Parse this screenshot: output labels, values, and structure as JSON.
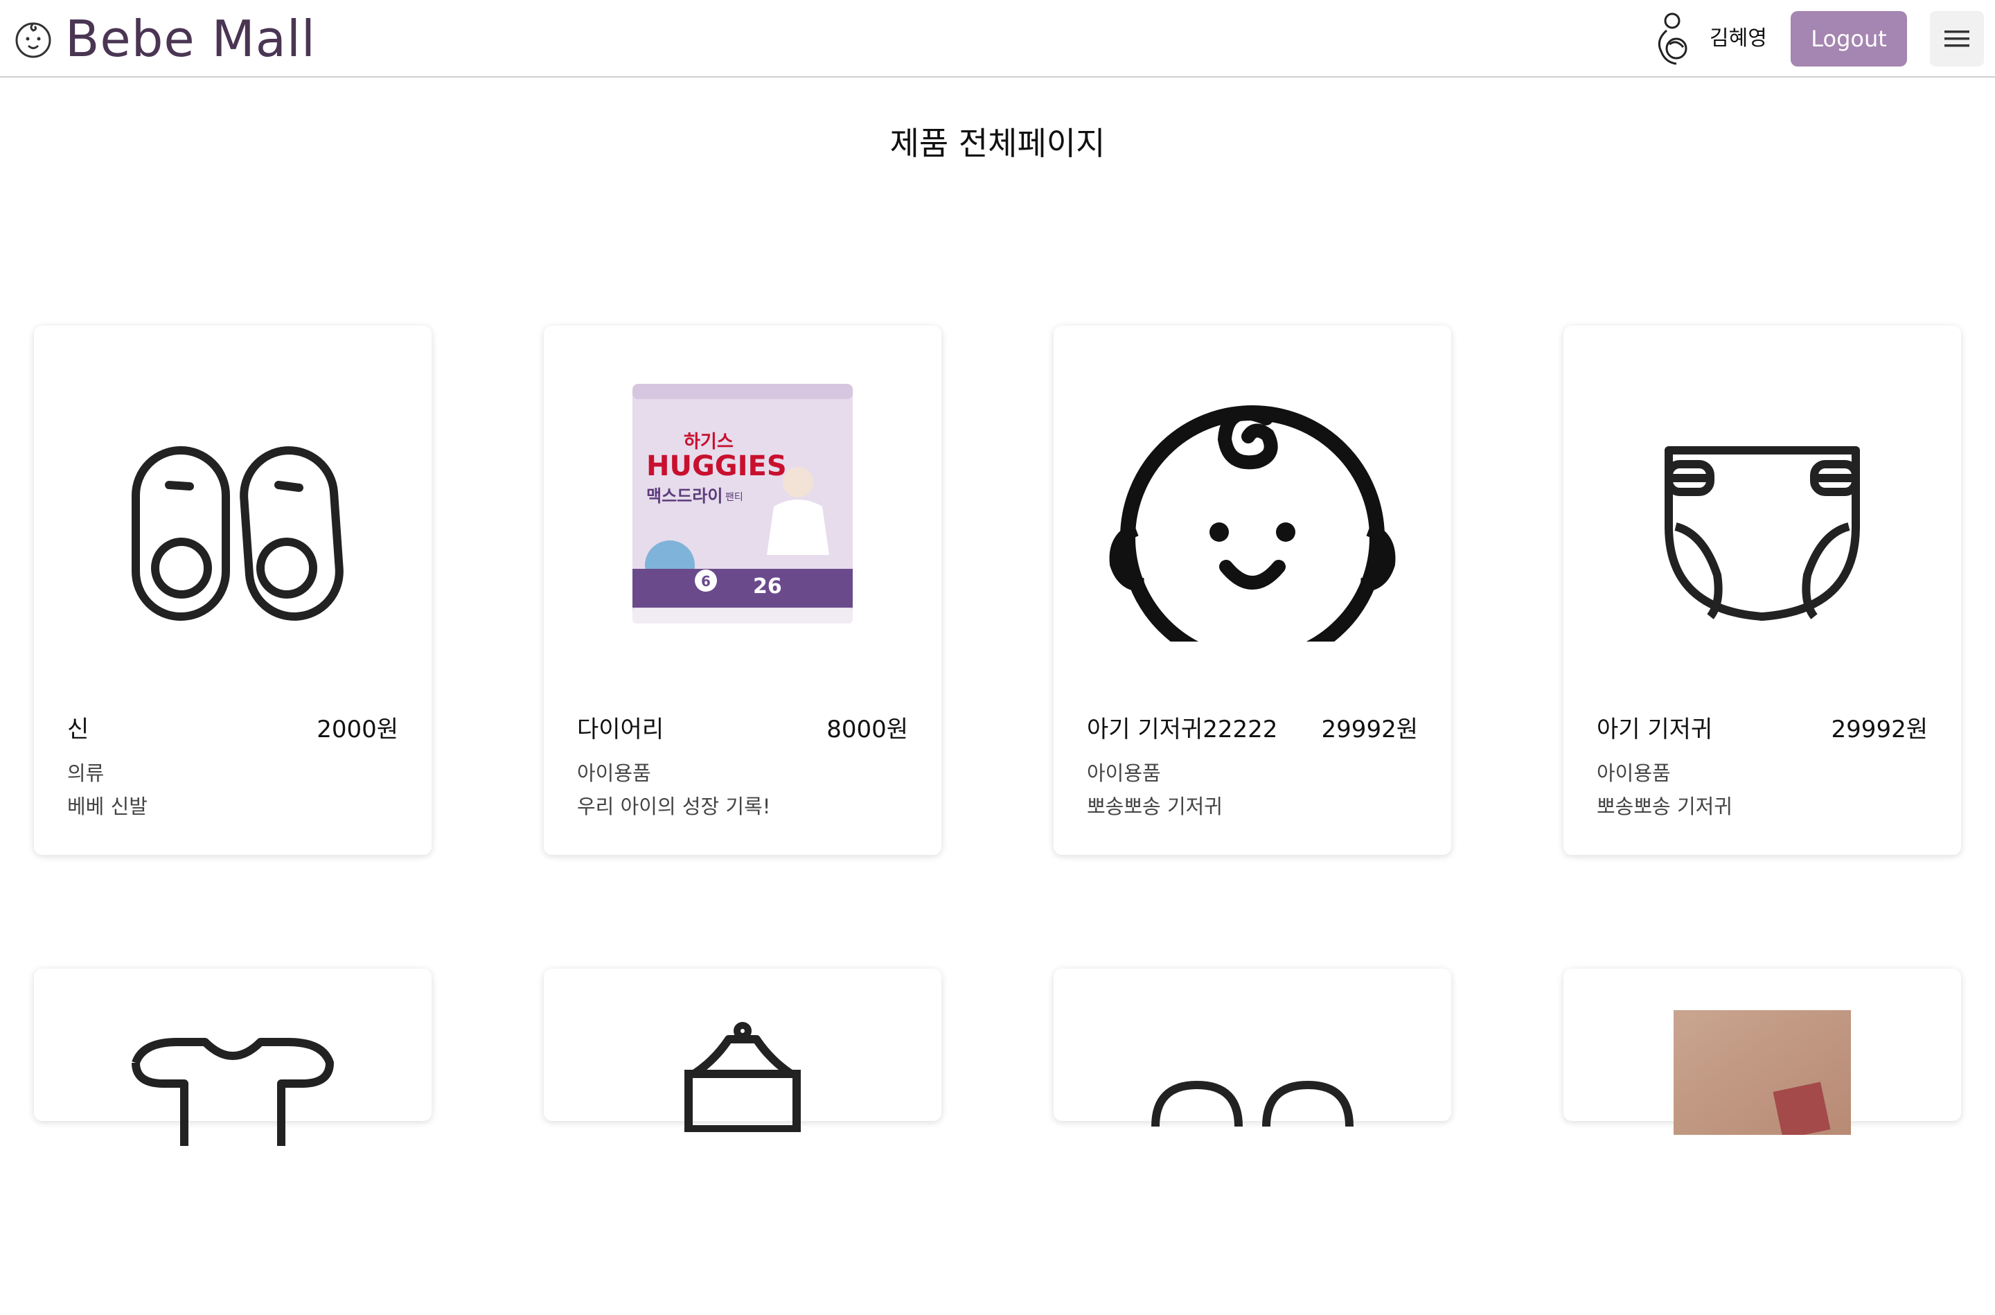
{
  "header": {
    "brand_name": "Bebe Mall",
    "brand_icon": "baby-face-icon",
    "user_icon": "mother-baby-icon",
    "user_name": "김혜영",
    "logout_label": "Logout",
    "menu_icon": "hamburger-menu-icon",
    "accent_color": "#a585b1",
    "brand_color": "#4a3553"
  },
  "page": {
    "title": "제품 전체페이지"
  },
  "products": [
    {
      "name": "신",
      "price": "2000원",
      "category": "의류",
      "description": "베베 신발",
      "image": "baby-shoes-icon"
    },
    {
      "name": "다이어리",
      "price": "8000원",
      "category": "아이용품",
      "description": "우리 아이의 성장 기록!",
      "image": "huggies-diaper-package-photo",
      "package_text": {
        "brand_kr": "하기스",
        "brand": "HUGGIES",
        "product": "맥스드라이",
        "type": "팬티",
        "size": "6",
        "count": "26"
      }
    },
    {
      "name": "아기 기저귀22222",
      "price": "29992원",
      "category": "아이용품",
      "description": "뽀송뽀송 기저귀",
      "image": "baby-face-icon"
    },
    {
      "name": "아기 기저귀",
      "price": "29992원",
      "category": "아이용품",
      "description": "뽀송뽀송 기저귀",
      "image": "diaper-icon"
    }
  ],
  "products_row2": [
    {
      "image": "baby-bodysuit-icon"
    },
    {
      "image": "baby-bottle-icon"
    },
    {
      "image": "baby-socks-icon"
    },
    {
      "image": "product-photo"
    }
  ]
}
